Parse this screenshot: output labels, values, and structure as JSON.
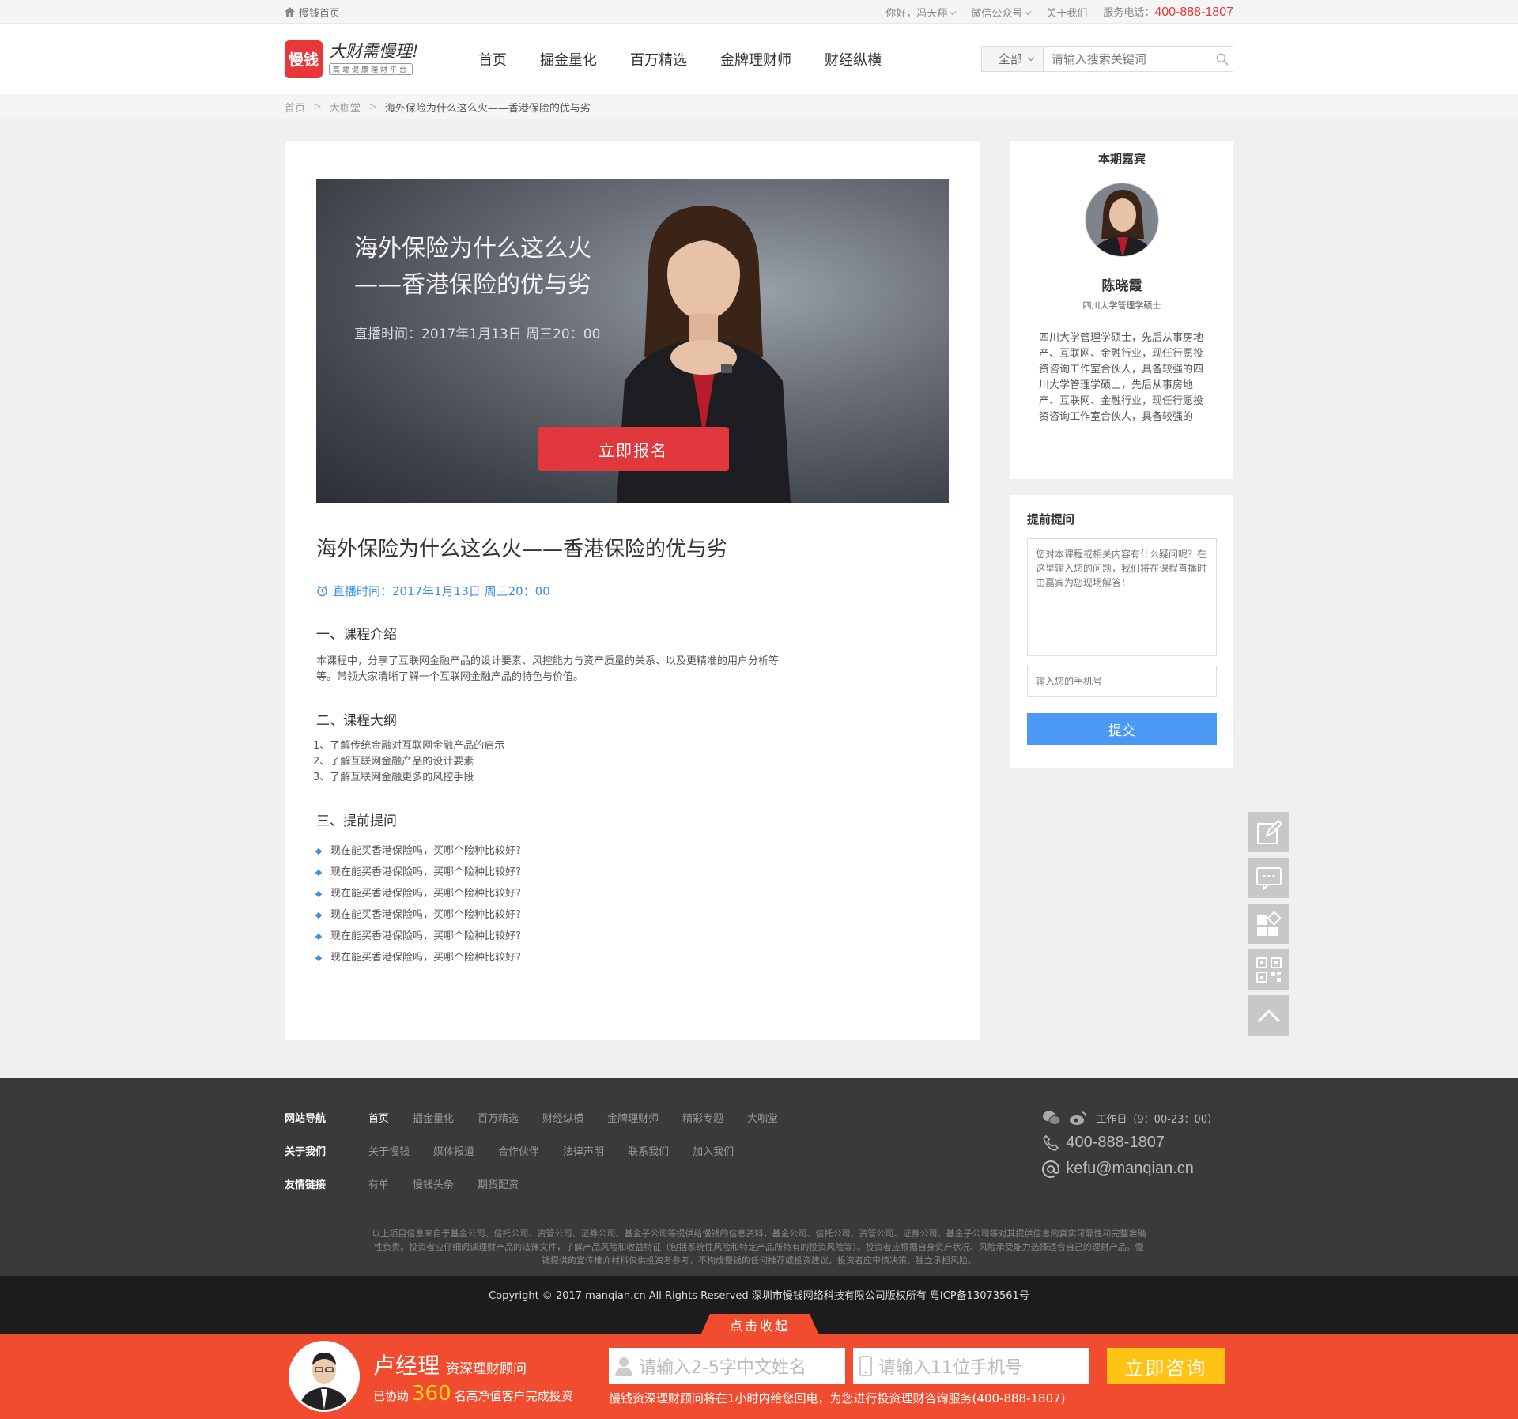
{
  "topbar": {
    "home": "慢钱首页",
    "greeting": "你好，冯天翔",
    "wechat": "微信公众号",
    "about": "关于我们",
    "service_label": "服务电话：",
    "service_phone": "400-888-1807"
  },
  "header": {
    "logo_mark": "慢钱",
    "slogan": "大财需慢理!",
    "sub": "高端健康理财平台",
    "nav": [
      "首页",
      "掘金量化",
      "百万精选",
      "金牌理财师",
      "财经纵横"
    ],
    "search": {
      "scope": "全部",
      "placeholder": "请输入搜索关键词"
    }
  },
  "breadcrumb": [
    "首页",
    "大咖堂",
    "海外保险为什么这么火——香港保险的优与劣"
  ],
  "banner": {
    "title_line1": "海外保险为什么这么火",
    "title_line2": "——香港保险的优与劣",
    "time": "直播时间：2017年1月13日   周三20：00",
    "signup": "立即报名"
  },
  "article": {
    "title": "海外保险为什么这么火——香港保险的优与劣",
    "time": "直播时间：2017年1月13日   周三20：00",
    "sec1_title": "一、课程介绍",
    "sec1_text": "本课程中，分享了互联网金融产品的设计要素、风控能力与资产质量的关系、以及更精准的用户分析等等。带领大家清晰了解一个互联网金融产品的特色与价值。",
    "sec2_title": "二、课程大纲",
    "outline": [
      "1、了解传统金融对互联网金融产品的启示",
      "2、了解互联网金融产品的设计要素",
      "3、了解互联网金融更多的风控手段"
    ],
    "sec3_title": "三、提前提问",
    "questions": [
      "现在能买香港保险吗，买哪个险种比较好?",
      "现在能买香港保险吗，买哪个险种比较好?",
      "现在能买香港保险吗，买哪个险种比较好?",
      "现在能买香港保险吗，买哪个险种比较好?",
      "现在能买香港保险吗，买哪个险种比较好?",
      "现在能买香港保险吗，买哪个险种比较好?"
    ]
  },
  "guest": {
    "heading": "本期嘉宾",
    "name": "陈晓霞",
    "degree": "四川大学管理学硕士",
    "bio": "四川大学管理学硕士，先后从事房地产、互联网、金融行业，现任行愿投资咨询工作室合伙人，具备较强的四川大学管理学硕士，先后从事房地产、互联网、金融行业，现任行愿投资咨询工作室合伙人，具备较强的"
  },
  "ask": {
    "heading": "提前提问",
    "question_placeholder": "您对本课程或相关内容有什么疑问呢？在这里输入您的问题，我们将在课程直播时由嘉宾为您现场解答！",
    "phone_placeholder": "输入您的手机号",
    "submit": "提交"
  },
  "footer": {
    "nav_label": "网站导航",
    "nav_links": [
      "首页",
      "掘金量化",
      "百万精选",
      "财经纵横",
      "金牌理财师",
      "精彩专题",
      "大咖堂"
    ],
    "about_label": "关于我们",
    "about_links": [
      "关于慢钱",
      "媒体报道",
      "合作伙伴",
      "法律声明",
      "联系我们",
      "加入我们"
    ],
    "friends_label": "友情链接",
    "friend_links": [
      "有单",
      "慢钱头条",
      "期货配资"
    ],
    "hours": "工作日（9：00-23：00）",
    "phone": "400-888-1807",
    "email": "kefu@manqian.cn",
    "disclaimer": "以上项目信息来自于基金公司、信托公司、资管公司、证券公司、基金子公司等提供给慢钱的信息资料，基金公司、信托公司、资管公司、证券公司、基金子公司等对其提供信息的真实可靠性和完整准确性负责。投资者应仔细阅读理财产品的法律文件，了解产品风险和收益特征（包括系统性风险和特定产品所特有的投资风险等）。投资者应根据自身资产状况、风险承受能力选择适合自己的理财产品。慢钱提供的宣传推介材料仅供投资者参考，不构成慢钱的任何推荐或投资建议。投资者应审慎决策、独立承担风险。",
    "copyright": "Copyright © 2017 manqian.cn All Rights Reserved 深圳市慢钱网络科技有限公司版权所有 粤ICP备13073561号"
  },
  "bottombar": {
    "collapse": "点击收起",
    "manager_name": "卢经理",
    "manager_title": "资深理财顾问",
    "stat_prefix": "已协助",
    "stat_count": "360",
    "stat_suffix": "名高净值客户完成投资",
    "name_placeholder": "请输入2-5字中文姓名",
    "phone_placeholder": "请输入11位手机号",
    "consult": "立即咨询",
    "note": "慢钱资深理财顾问将在1小时内给您回电，为您进行投资理财咨询服务(400-888-1807)"
  },
  "colors": {
    "brand_red": "#e8363a",
    "link_blue": "#3b8fe6",
    "bar_orange": "#f14c2f",
    "consult_yellow": "#ffc315"
  }
}
